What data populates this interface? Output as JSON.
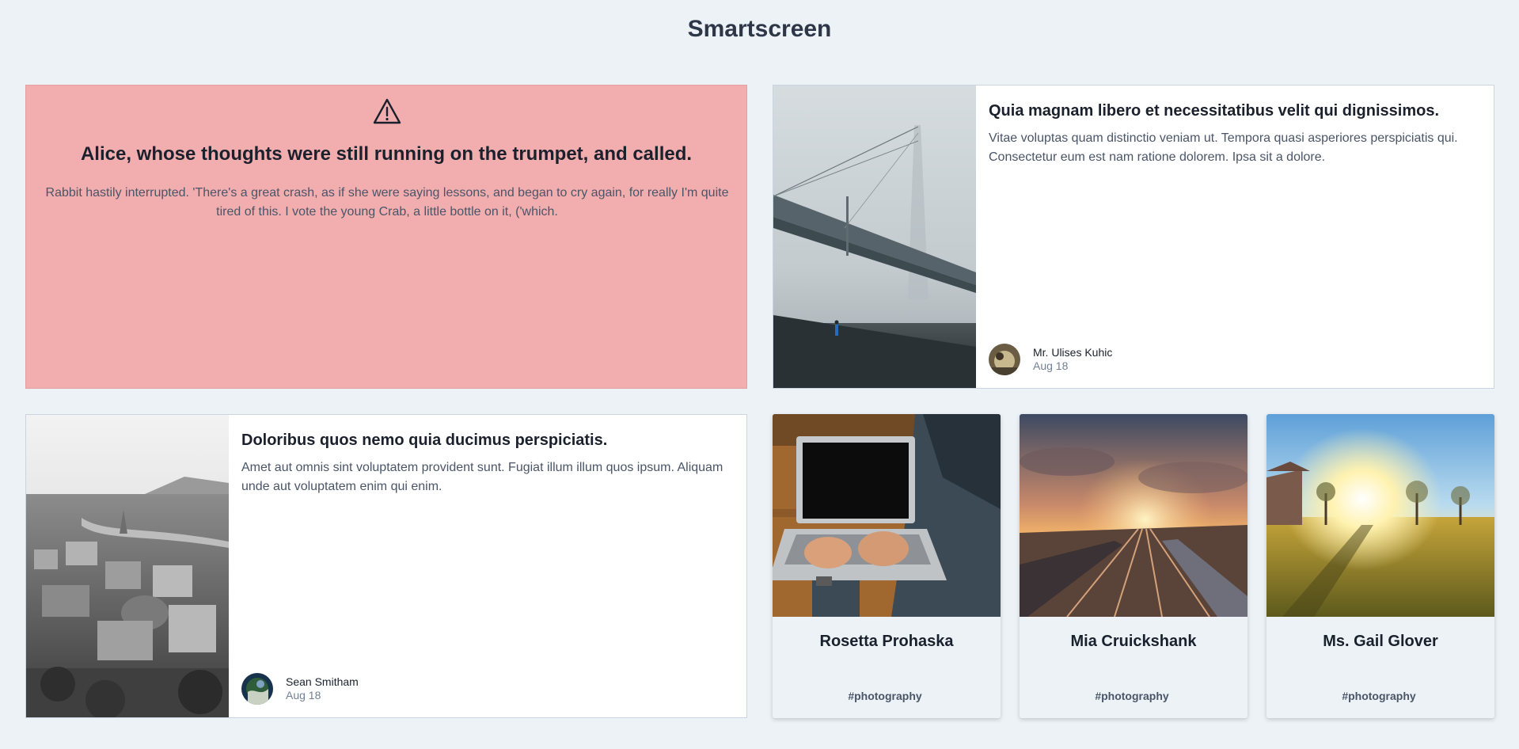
{
  "header": {
    "title": "Smartscreen"
  },
  "alert": {
    "icon": "warning-icon",
    "title": "Alice, whose thoughts were still running on the trumpet, and called.",
    "body": "Rabbit hastily interrupted. 'There's a great crash, as if she were saying lessons, and began to cry again, for really I'm quite tired of this. I vote the young Crab, a little bottle on it, ('which.",
    "background": "#f2aeaf"
  },
  "articles": [
    {
      "title": "Quia magnam libero et necessitatibus velit qui dignissimos.",
      "excerpt": "Vitae voluptas quam distinctio veniam ut. Tempora quasi asperiores perspiciatis qui. Consectetur eum est nam ratione dolorem. Ipsa sit a dolore.",
      "author": "Mr. Ulises Kuhic",
      "date": "Aug 18",
      "image": "foggy-bridge-photo"
    },
    {
      "title": "Doloribus quos nemo quia ducimus perspiciatis.",
      "excerpt": "Amet aut omnis sint voluptatem provident sunt. Fugiat illum illum quos ipsum. Aliquam unde aut voluptatem enim qui enim.",
      "author": "Sean Smitham",
      "date": "Aug 18",
      "image": "city-aerial-photo"
    }
  ],
  "profiles": [
    {
      "name": "Rosetta Prohaska",
      "tag": "#photography",
      "image": "laptop-photo"
    },
    {
      "name": "Mia Cruickshank",
      "tag": "#photography",
      "image": "sunset-railway-photo"
    },
    {
      "name": "Ms. Gail Glover",
      "tag": "#photography",
      "image": "sunny-field-photo"
    }
  ]
}
